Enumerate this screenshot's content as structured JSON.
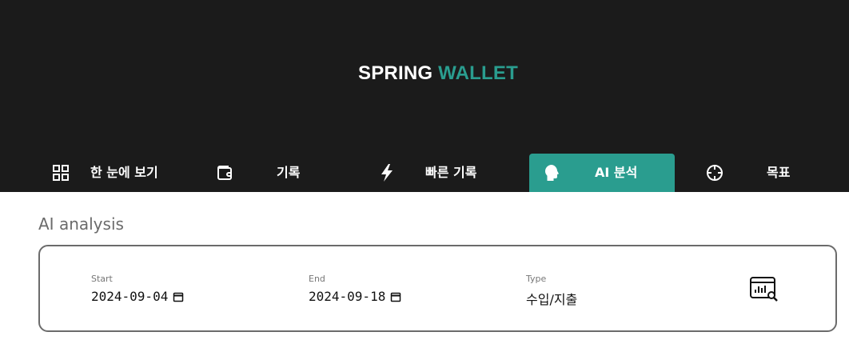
{
  "header": {
    "brand_part1": "SPRING",
    "brand_part2": "WALLET",
    "accent_color": "#2a9d8f",
    "background_color": "#1b1b1b"
  },
  "nav": {
    "items": [
      {
        "label": "한 눈에 보기",
        "icon": "grid-icon",
        "active": false
      },
      {
        "label": "기록",
        "icon": "wallet-icon",
        "active": false
      },
      {
        "label": "빠른 기록",
        "icon": "lightning-icon",
        "active": false
      },
      {
        "label": "AI 분석",
        "icon": "ai-head-icon",
        "active": true
      },
      {
        "label": "목표",
        "icon": "target-icon",
        "active": false
      }
    ]
  },
  "main": {
    "title": "AI analysis",
    "filters": {
      "start": {
        "label": "Start",
        "value": "2024-09-04",
        "icon": "calendar-icon"
      },
      "end": {
        "label": "End",
        "value": "2024-09-18",
        "icon": "calendar-icon"
      },
      "type": {
        "label": "Type",
        "value": "수입/지출"
      },
      "search_icon": "chart-search-icon"
    }
  }
}
